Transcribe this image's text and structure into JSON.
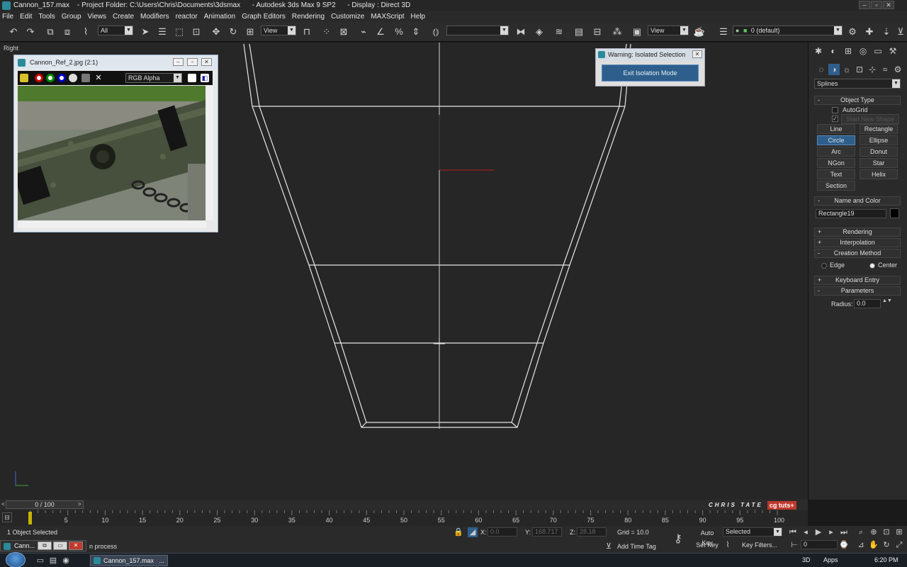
{
  "titlebar": {
    "title": "Cannon_157.max    - Project Folder: C:\\Users\\Chris\\Documents\\3dsmax      - Autodesk 3ds Max 9 SP2      - Display : Direct 3D"
  },
  "menu": [
    "File",
    "Edit",
    "Tools",
    "Group",
    "Views",
    "Create",
    "Modifiers",
    "reactor",
    "Animation",
    "Graph Editors",
    "Rendering",
    "Customize",
    "MAXScript",
    "Help"
  ],
  "toolbar": {
    "selection_filter": "All",
    "ref_coord_1": "View",
    "ref_coord_2": "View",
    "layer": "0 (default)"
  },
  "viewport": {
    "label": "Right"
  },
  "ref_image_window": {
    "title": "Cannon_Ref_2.jpg (2:1)",
    "channel": "RGB Alpha",
    "close_glyph": "✕"
  },
  "warning": {
    "title": "Warning: Isolated Selection",
    "button": "Exit Isolation Mode"
  },
  "command_panel": {
    "category": "Splines",
    "object_type": {
      "header": "Object Type",
      "autogrid": "AutoGrid",
      "start_new_shape": "Start New Shape",
      "buttons": [
        "Line",
        "Rectangle",
        "Circle",
        "Ellipse",
        "Arc",
        "Donut",
        "NGon",
        "Star",
        "Text",
        "Helix",
        "Section"
      ],
      "active": "Circle"
    },
    "name_color": {
      "header": "Name and Color",
      "name": "Rectangle19"
    },
    "rollouts": {
      "rendering": "Rendering",
      "interpolation": "Interpolation",
      "creation_method": "Creation Method",
      "edge": "Edge",
      "center": "Center",
      "keyboard_entry": "Keyboard Entry",
      "parameters": "Parameters",
      "radius_label": "Radius:",
      "radius_value": "0.0"
    },
    "plus": "+",
    "minus": "-"
  },
  "time_slider": {
    "label": "0 / 100",
    "prev": "<",
    "next": ">"
  },
  "branding": {
    "author": "CHRIS TATE",
    "logo_cg": "cg",
    "logo_tuts": "tuts+"
  },
  "trackbar": {
    "ticks": [
      "0",
      "5",
      "10",
      "15",
      "20",
      "25",
      "30",
      "35",
      "40",
      "45",
      "50",
      "55",
      "60",
      "65",
      "70",
      "75",
      "80",
      "85",
      "90",
      "95",
      "100"
    ]
  },
  "status": {
    "objects_selected": "1 Object Selected",
    "prompt": "n process",
    "x_label": "X:",
    "x_value": "0.0",
    "y_label": "Y:",
    "y_value": "168.717",
    "z_label": "Z:",
    "z_value": "28.18",
    "grid": "Grid = 10.0",
    "add_time_tag": "Add Time Tag",
    "auto_key": "Auto Key",
    "selected": "Selected",
    "set_key": "Set Key",
    "key_filters": "Key Filters...",
    "frame": "0"
  },
  "maxscript_mini": {
    "label": "Cann..."
  },
  "taskbar": {
    "task": "Cannon_157.max",
    "ellipsis": "...",
    "display": "3D",
    "apps": "Apps",
    "clock": "6:20 PM"
  }
}
